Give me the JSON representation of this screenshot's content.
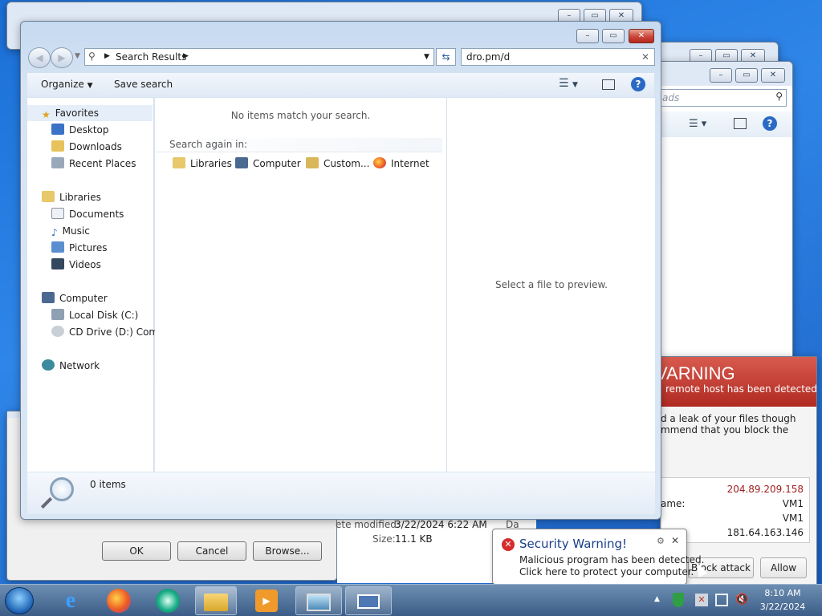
{
  "explorer": {
    "address_segment": "Search Results",
    "search_value": "dro.pm/d",
    "organize": "Organize",
    "save_search": "Save search",
    "no_items": "No items match your search.",
    "search_again": "Search again in:",
    "search_targets": [
      "Libraries",
      "Computer",
      "Custom...",
      "Internet"
    ],
    "preview_text": "Select a file to preview.",
    "status_count": "0 items"
  },
  "nav": {
    "favorites": "Favorites",
    "desktop": "Desktop",
    "downloads": "Downloads",
    "recent": "Recent Places",
    "libraries": "Libraries",
    "documents": "Documents",
    "music": "Music",
    "pictures": "Pictures",
    "videos": "Videos",
    "computer": "Computer",
    "local_disk": "Local Disk (C:)",
    "cd_drive": "CD Drive (D:) Come",
    "network": "Network"
  },
  "bg_window": {
    "search_placeholder": "ads"
  },
  "file_dialog": {
    "ok": "OK",
    "cancel": "Cancel",
    "browse": "Browse...",
    "date_label": "ete modified:",
    "date_value": "3/22/2024 6:22 AM",
    "date_extra": "Da",
    "size_label": "Size:",
    "size_value": "11.1 KB"
  },
  "alert": {
    "heading": "VARNING",
    "subheading": "remote host has been detected",
    "line1": "d a leak of your files though",
    "line2": "mmend that you block the",
    "rows": [
      {
        "label": "",
        "value": "204.89.209.158"
      },
      {
        "label": "ame:",
        "value": "VM1"
      },
      {
        "label": "",
        "value": "VM1"
      },
      {
        "label": "",
        "value": "181.64.163.146"
      }
    ],
    "block": "Block attack",
    "allow": "Allow",
    "accent": "#c0392b"
  },
  "balloon": {
    "title": "Security Warning!",
    "line1": "Malicious program has been detected.",
    "line2": "Click here to protect your computer."
  },
  "taskbar": {
    "time": "8:10 AM",
    "date": "3/22/2024"
  }
}
